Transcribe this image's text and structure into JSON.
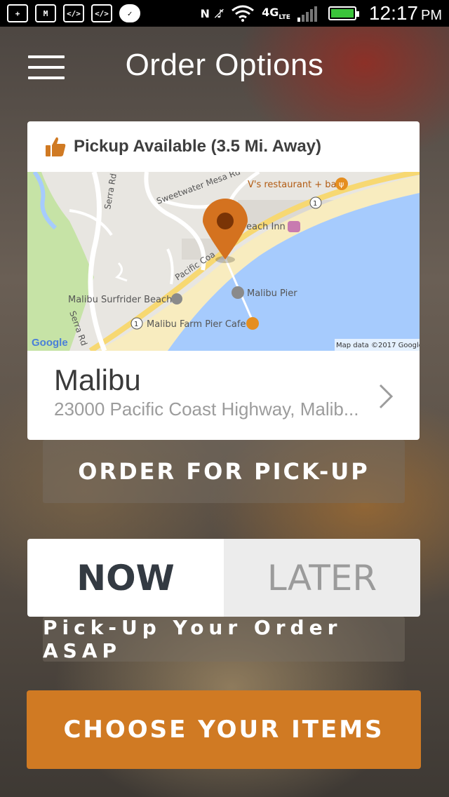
{
  "status_bar": {
    "time": "12:17",
    "ampm": "PM",
    "network": "4G",
    "network_sub": "LTE",
    "icons": [
      "add-icon",
      "gmail-icon",
      "code-icon",
      "code-icon",
      "check-bubble-icon",
      "nfc-icon",
      "mute-icon",
      "wifi-icon",
      "signal-icon",
      "battery-charging-icon"
    ]
  },
  "header": {
    "title": "Order Options",
    "menu_icon": "hamburger-menu-icon"
  },
  "location": {
    "pickup_status": "Pickup Available (3.5 Mi. Away)",
    "name": "Malibu",
    "address": "23000 Pacific Coast Highway, Malib...",
    "map": {
      "labels": {
        "serra_rd_1": "Serra Rd",
        "serra_rd_2": "Serra Rd",
        "sweetwater": "Sweetwater Mesa Rd",
        "v_restaurant": "V's restaurant + bar",
        "beach_inn": "each Inn",
        "pch": "Pacific Coa",
        "pier": "Malibu Pier",
        "surfrider": "Malibu Surfrider Beach",
        "farm_cafe": "Malibu Farm Pier Cafe",
        "route_1a": "1",
        "route_1b": "1",
        "google": "Google",
        "attribution": "Map data ©2017 Google"
      }
    }
  },
  "actions": {
    "order_pickup": "ORDER FOR PICK-UP",
    "now": "NOW",
    "later": "LATER",
    "asap_text": "Pick-Up Your Order ASAP",
    "choose_items": "CHOOSE YOUR ITEMS"
  },
  "colors": {
    "accent": "#d07a23",
    "pin": "#d4721f",
    "water": "#a6cbfd",
    "beach": "#f8ecbf",
    "park": "#c6e3a6"
  }
}
